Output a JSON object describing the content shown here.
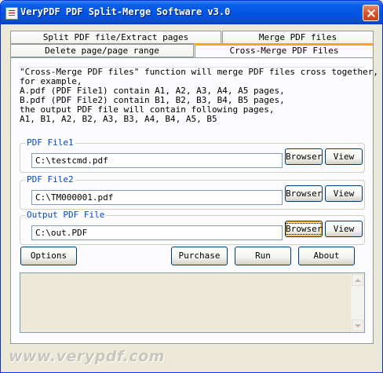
{
  "window": {
    "title": "VeryPDF PDF Split-Merge Software v3.0"
  },
  "tabs": {
    "row1": [
      "Split PDF file/Extract pages",
      "Merge PDF files"
    ],
    "row2": [
      "Delete page/page range",
      "Cross-Merge PDF Files"
    ],
    "active": "Cross-Merge PDF Files"
  },
  "description": [
    "\"Cross-Merge PDF files\" function will merge PDF files cross together,",
    "for example,",
    "A.pdf (PDF File1) contain A1, A2, A3, A4, A5 pages,",
    "B.pdf (PDF File2) contain B1, B2, B3, B4, B5 pages,",
    "the output PDF file will contain following pages,",
    "A1, B1, A2, B2, A3, B3, A4, B4, A5, B5"
  ],
  "file1": {
    "label": "PDF File1",
    "value": "C:\\testcmd.pdf",
    "browse": "Browser",
    "view": "View"
  },
  "file2": {
    "label": "PDF File2",
    "value": "C:\\TM000001.pdf",
    "browse": "Browser",
    "view": "View"
  },
  "output": {
    "label": "Output PDF File",
    "value": "C:\\out.PDF",
    "browse": "Browser",
    "view": "View"
  },
  "actions": {
    "options": "Options",
    "purchase": "Purchase",
    "run": "Run",
    "about": "About"
  },
  "log": {
    "text": ""
  },
  "footer": "www.verypdf.com"
}
